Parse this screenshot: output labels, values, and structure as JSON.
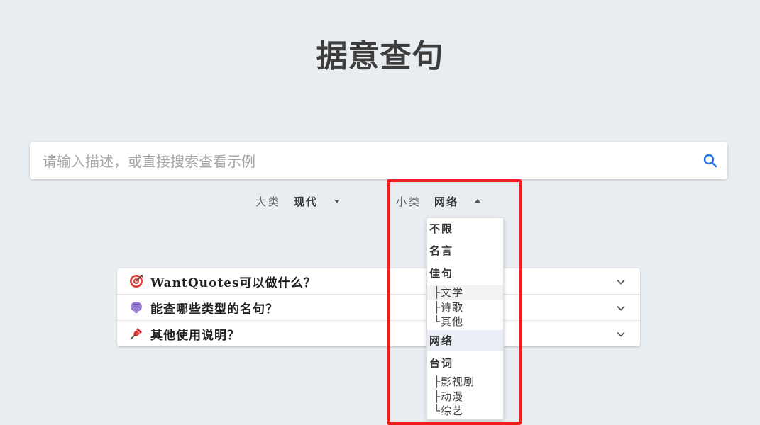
{
  "title": "据意查句",
  "search": {
    "placeholder": "请输入描述，或直接搜索查看示例",
    "value": ""
  },
  "filters": {
    "major": {
      "label": "大类",
      "value": "现代"
    },
    "minor": {
      "label": "小类",
      "value": "网络"
    }
  },
  "faq": [
    {
      "icon": "target-icon",
      "text": "WantQuotes可以做什么？"
    },
    {
      "icon": "brain-icon",
      "text": "能查哪些类型的名句？"
    },
    {
      "icon": "pushpin-icon",
      "text": "其他使用说明？"
    }
  ],
  "dropdown": {
    "options": [
      {
        "kind": "group",
        "label": "不限"
      },
      {
        "kind": "group",
        "label": "名言"
      },
      {
        "kind": "group",
        "label": "佳句"
      },
      {
        "kind": "sub",
        "tree": "├",
        "label": "文学"
      },
      {
        "kind": "sub",
        "tree": "├",
        "label": "诗歌"
      },
      {
        "kind": "sub",
        "tree": "└",
        "label": "其他"
      },
      {
        "kind": "group",
        "label": "网络",
        "selected": true
      },
      {
        "kind": "group",
        "label": "台词"
      },
      {
        "kind": "sub",
        "tree": "├",
        "label": "影视剧"
      },
      {
        "kind": "sub",
        "tree": "├",
        "label": "动漫"
      },
      {
        "kind": "sub",
        "tree": "└",
        "label": "综艺"
      }
    ]
  },
  "colors": {
    "background": "#e8edf1",
    "accent": "#1a73e8",
    "highlight": "#f21d1d",
    "selected_option": "#e9eef6"
  }
}
